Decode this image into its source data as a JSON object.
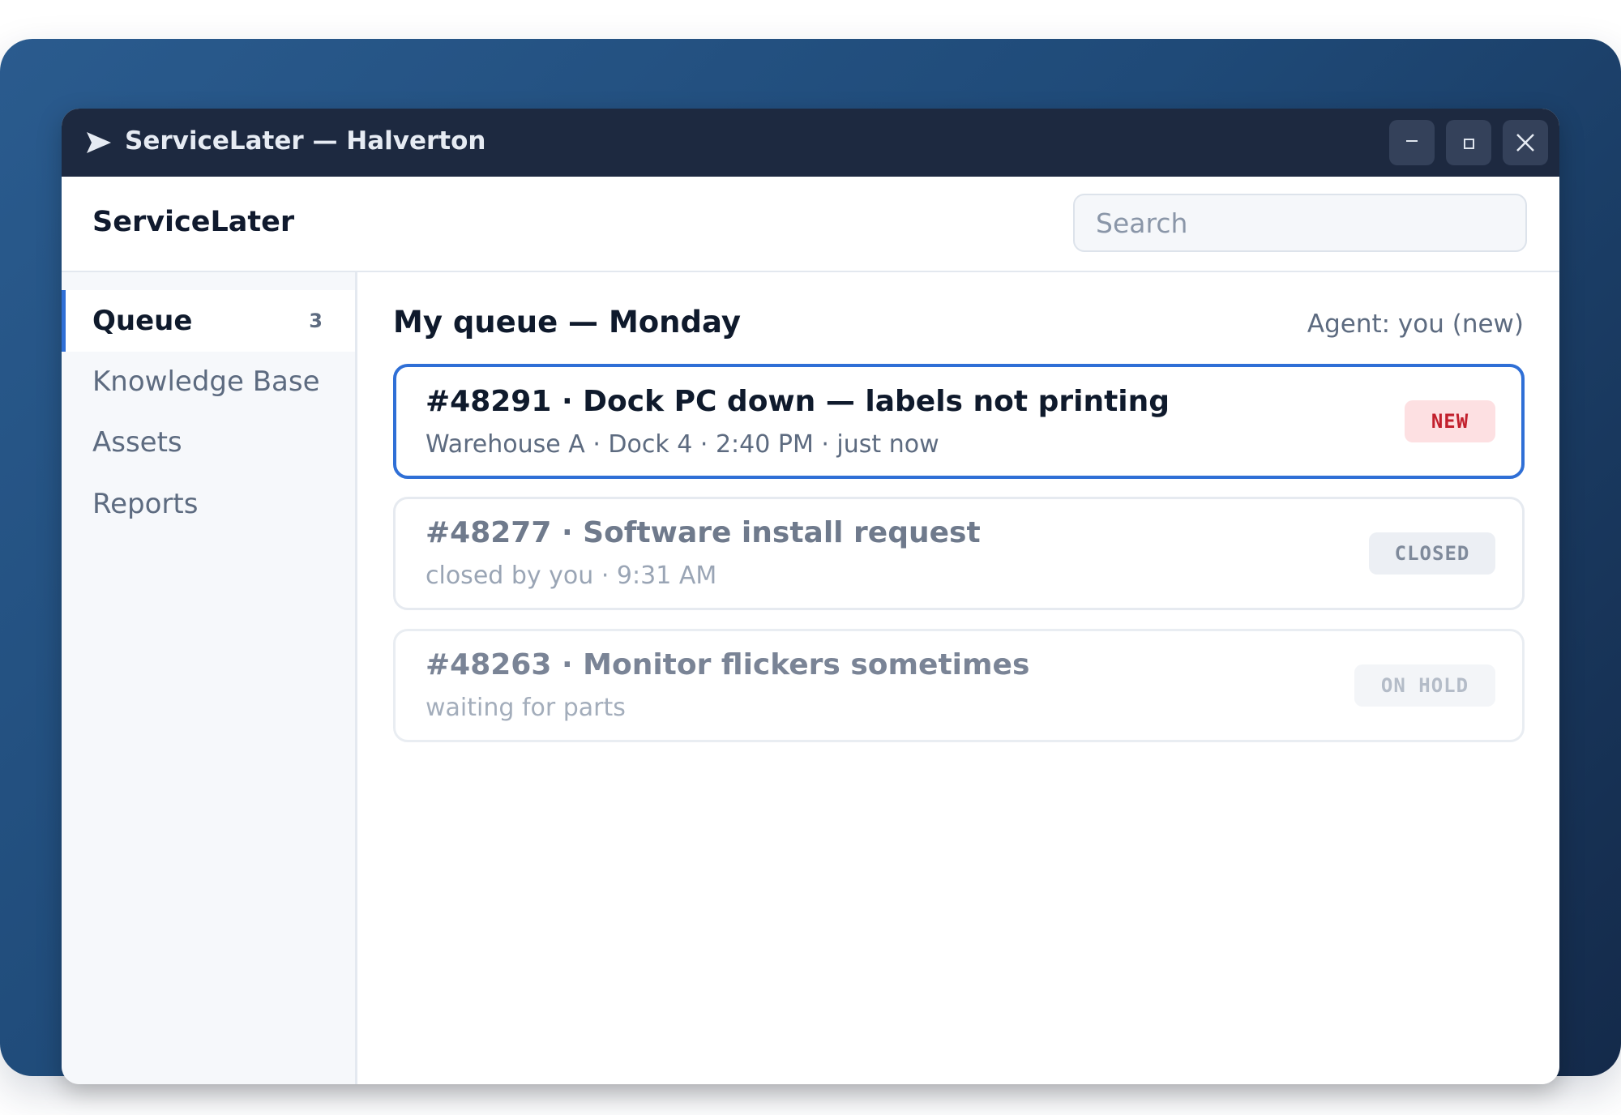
{
  "window": {
    "title": "ServiceLater — Halverton",
    "app_icon": "paper-plane-icon"
  },
  "header": {
    "brand": "ServiceLater",
    "search_placeholder": "Search"
  },
  "sidebar": {
    "items": [
      {
        "label": "Queue",
        "count": "3",
        "active": true
      },
      {
        "label": "Knowledge Base"
      },
      {
        "label": "Assets"
      },
      {
        "label": "Reports"
      }
    ]
  },
  "main": {
    "title": "My queue — Monday",
    "agent": "Agent: you (new)",
    "tickets": [
      {
        "title": "#48291 · Dock PC down — labels not printing",
        "subtitle": "Warehouse A · Dock 4 · 2:40 PM · just now",
        "status": "NEW"
      },
      {
        "title": "#48277 · Software install request",
        "subtitle": "closed by you · 9:31 AM",
        "status": "CLOSED"
      },
      {
        "title": "#48263 · Monitor flickers sometimes",
        "subtitle": "waiting for parts",
        "status": "ON HOLD"
      }
    ]
  },
  "colors": {
    "accent": "#2f6fd6",
    "titlebar": "#1d2940",
    "new_badge_bg": "#fde0e2",
    "new_badge_text": "#c2202d"
  }
}
